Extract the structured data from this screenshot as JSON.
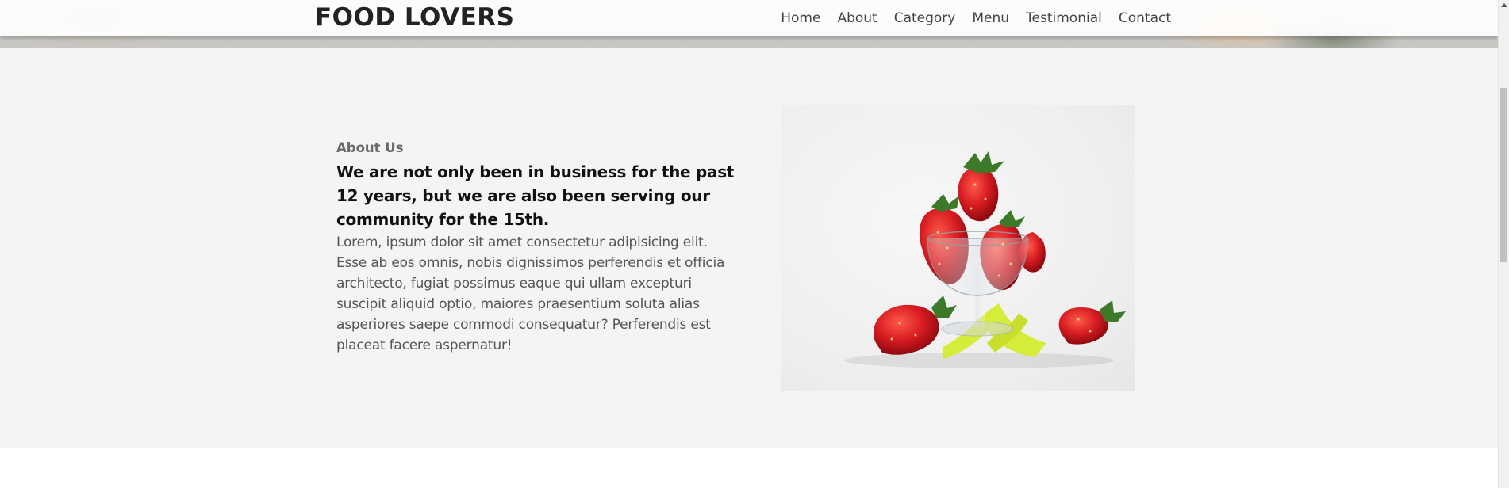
{
  "navbar": {
    "brand": "FOOD LOVERS",
    "links": [
      {
        "label": "Home"
      },
      {
        "label": "About"
      },
      {
        "label": "Category"
      },
      {
        "label": "Menu"
      },
      {
        "label": "Testimonial"
      },
      {
        "label": "Contact"
      }
    ]
  },
  "about": {
    "eyebrow": "About Us",
    "heading": "We are not only been in business for the past 12 years, but we are also been serving our community for the 15th.",
    "body": "Lorem, ipsum dolor sit amet consectetur adipisicing elit. Esse ab eos omnis, nobis dignissimos perferendis et officia architecto, fugiat possimus eaque qui ullam excepturi suscipit aliquid optio, maiores praesentium soluta alias asperiores saepe commodi consequatur? Perferendis est placeat facere aspernatur!",
    "image_icon": "strawberries-in-glass-bowl"
  },
  "colors": {
    "section_bg": "#f4f4f6",
    "brand_text": "#222222",
    "strawberry_red": "#d81c22",
    "ribbon_yellow": "#d6ec3a"
  }
}
